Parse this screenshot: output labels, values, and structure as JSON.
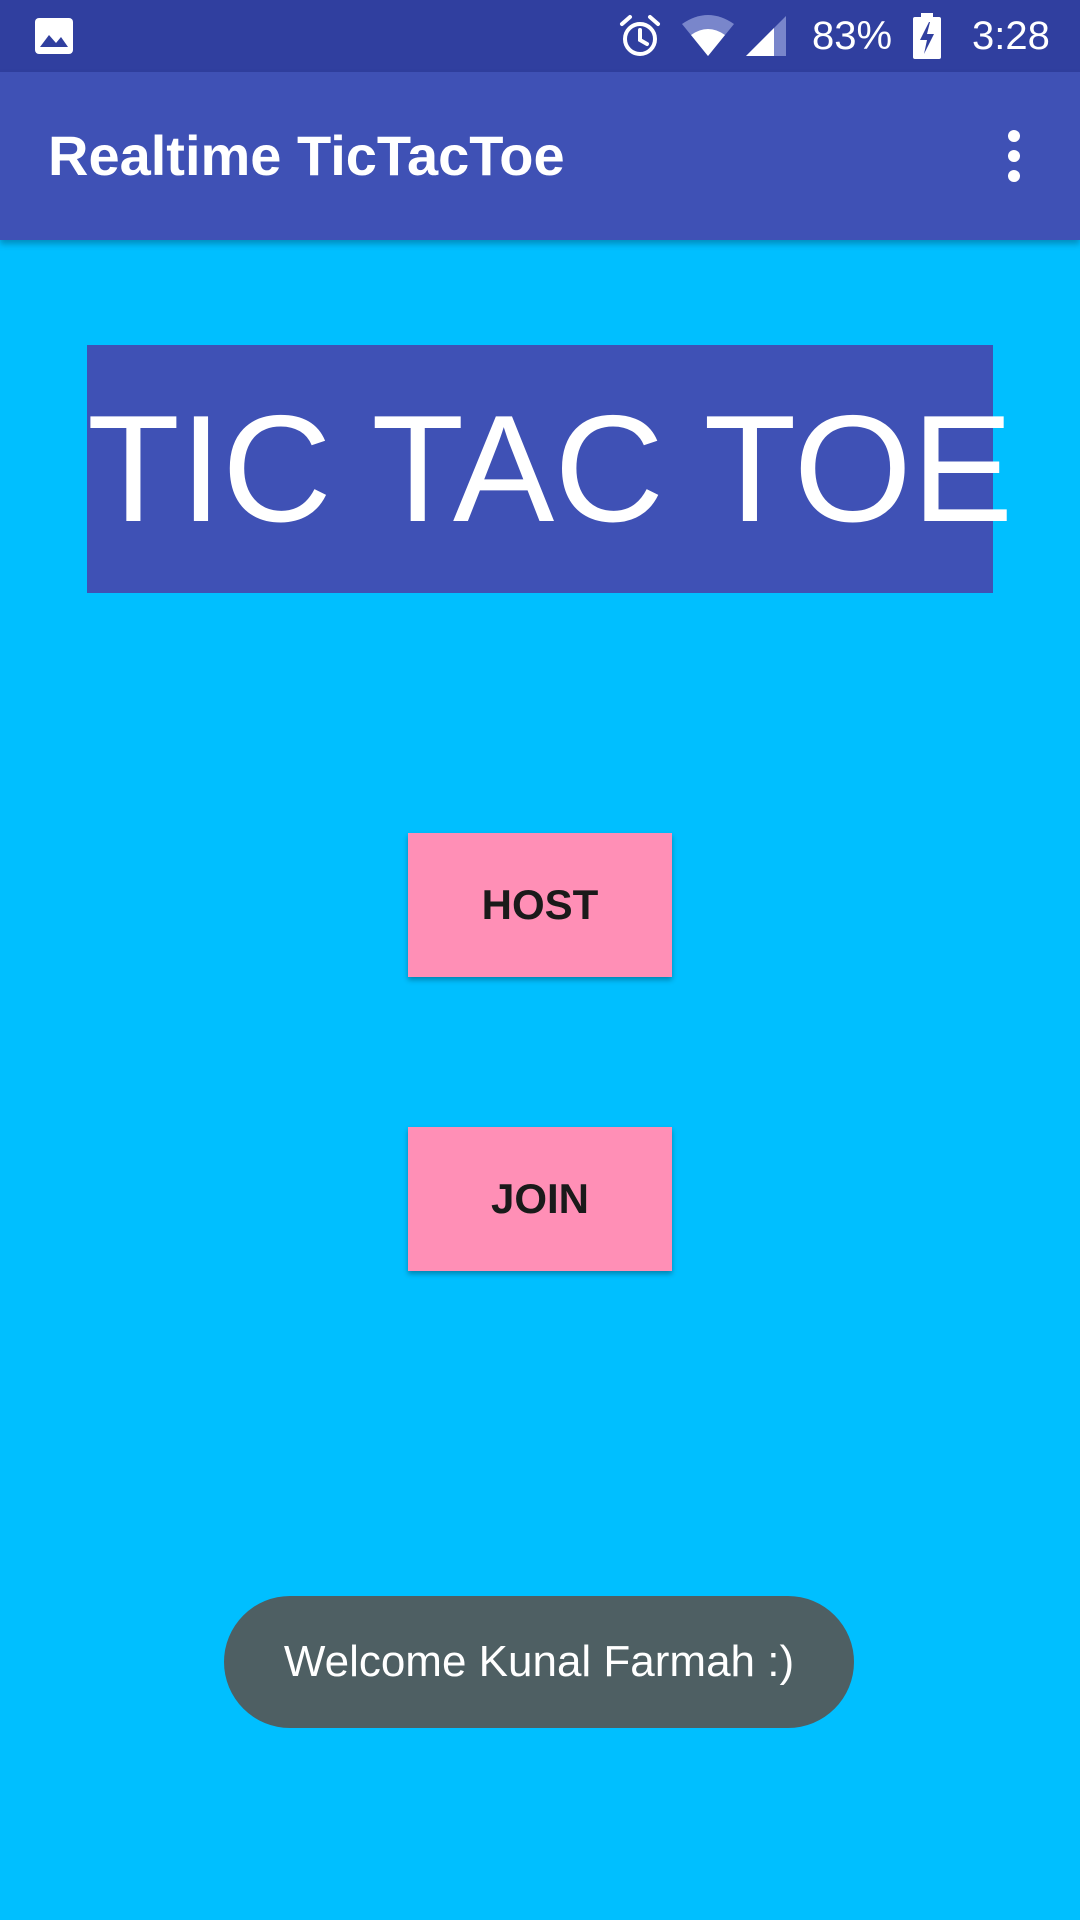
{
  "status_bar": {
    "icons": [
      "gallery-icon",
      "alarm-icon",
      "wifi-icon",
      "cell-signal-icon",
      "battery-charging-icon"
    ],
    "battery": "83%",
    "time": "3:28"
  },
  "app_bar": {
    "title": "Realtime TicTacToe",
    "menu_icon": "more-vert-icon"
  },
  "main": {
    "headline": "TIC TAC TOE",
    "host_label": "HOST",
    "join_label": "JOIN"
  },
  "toast": {
    "message": "Welcome Kunal Farmah :)"
  },
  "colors": {
    "status_bar": "#303F9F",
    "app_bar": "#3F51B5",
    "background": "#00BFFF",
    "headline_bg": "#3F51B5",
    "button": "#FF8FB6",
    "toast": "#4E5F63"
  }
}
